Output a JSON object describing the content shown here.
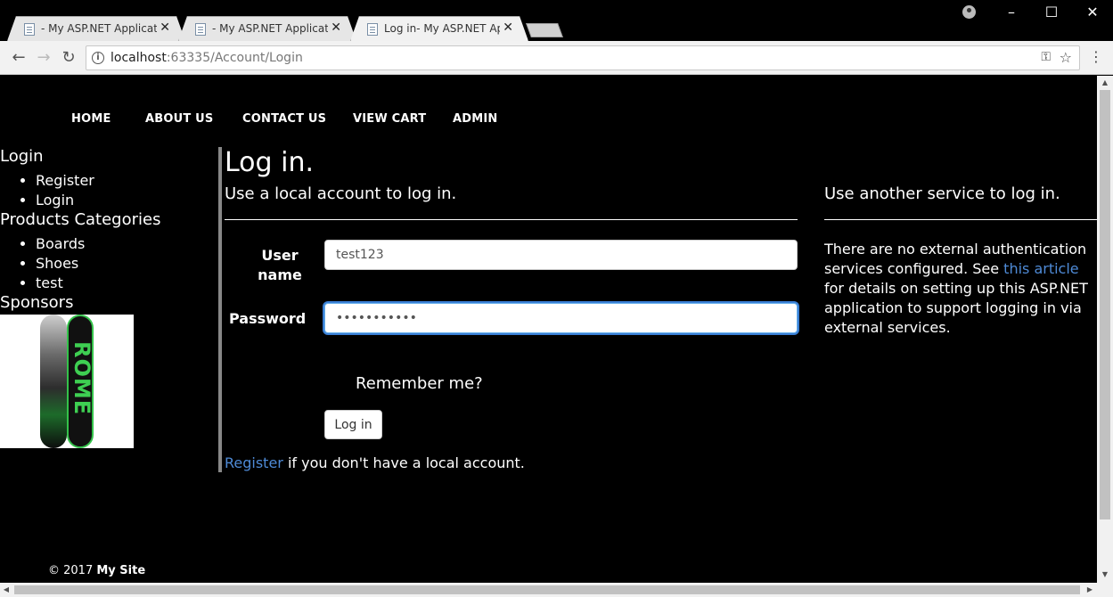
{
  "browser": {
    "tabs": [
      {
        "title": "- My ASP.NET Applicatio",
        "active": false
      },
      {
        "title": "- My ASP.NET Applicatio",
        "active": false
      },
      {
        "title": "Log in- My ASP.NET Appl",
        "active": true
      }
    ],
    "url_host": "localhost",
    "url_rest": ":63335/Account/Login",
    "icons": {
      "back": "arrow-left-icon",
      "forward": "arrow-right-icon",
      "reload": "reload-icon",
      "key": "key-icon",
      "star": "star-icon",
      "menu": "kebab-menu-icon",
      "profile": "profile-icon"
    }
  },
  "navbar": {
    "items": [
      "HOME",
      "ABOUT US",
      "CONTACT US",
      "VIEW CART",
      "ADMIN"
    ]
  },
  "sidebar": {
    "login_heading": "Login",
    "account_links": [
      "Register",
      "Login"
    ],
    "categories_heading": "Products Categories",
    "categories": [
      "Boards",
      "Shoes",
      "test"
    ],
    "sponsors_heading": "Sponsors",
    "sponsor_image_text": "ROME"
  },
  "login": {
    "title": "Log in.",
    "subtitle": "Use a local account to log in.",
    "username_label": "User name",
    "username_value": "test123",
    "password_label": "Password",
    "password_value": "•••••••••••",
    "remember_label": "Remember me?",
    "submit_label": "Log in",
    "register_link": "Register",
    "register_suffix": " if you don't have a local account."
  },
  "external": {
    "subtitle": "Use another service to log in.",
    "text_before": "There are no external authentication services configured. See ",
    "link_text": "this article",
    "text_after": " for details on setting up this ASP.NET application to support logging in via external services."
  },
  "footer": {
    "copyright": "© 2017 ",
    "site": "My Site"
  },
  "colors": {
    "link": "#4e8ad6",
    "background": "#000000",
    "focus": "#3a7fd5"
  }
}
